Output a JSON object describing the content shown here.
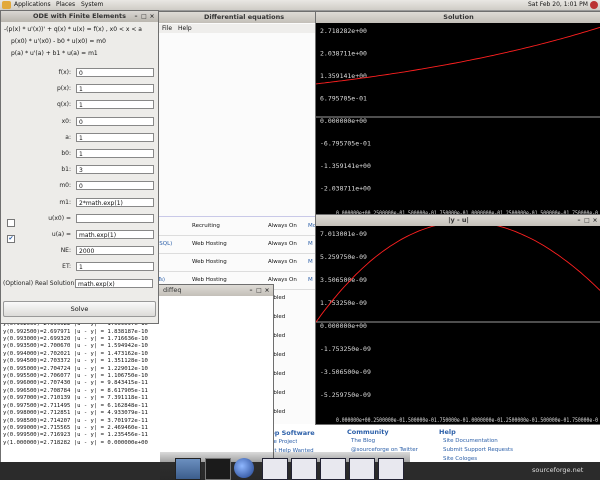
{
  "top_panel": {
    "menus": [
      "Applications",
      "Places",
      "System"
    ],
    "clock": "Sat Feb 20,  1:01 PM"
  },
  "diffeq_window": {
    "title": "Differential equations",
    "menu": [
      "File",
      "Help"
    ],
    "table_rows": [
      {
        "name": "",
        "category": "Recruiting",
        "status": "Always On",
        "mark": "Mo"
      },
      {
        "name": "ySQL)",
        "category": "Web Hosting",
        "status": "Always On",
        "mark": "M"
      },
      {
        "name": "",
        "category": "Web Hosting",
        "status": "Always On",
        "mark": "M"
      },
      {
        "name": "ITs)",
        "category": "Web Hosting",
        "status": "Always On",
        "mark": "M"
      }
    ],
    "side_words": [
      "abled",
      "abled",
      "abled",
      "abled",
      "abled",
      "abled",
      "abled"
    ],
    "footer": {
      "col1_title": "lop Software",
      "col1_items": [
        "ate Project",
        "ect Help Wanted"
      ],
      "col2_title": "Community",
      "col2_items": [
        "The Blog",
        "@sourceforge on Twitter"
      ],
      "col3_title": "Help",
      "col3_items": [
        "Site Documentation",
        "Submit Support Requests",
        "Site Cologes"
      ],
      "brand": "sourceforge.net"
    }
  },
  "ode_window": {
    "title": "ODE with Finite Elements",
    "equations": [
      "-(p(x) * u'(x))' + q(x) * u(x) = f(x)    , x0 < x < a",
      "p(x0) * u'(x0) - b0 * u(x0) = m0",
      "p(a) * u'(a) + b1 * u(a) = m1"
    ],
    "fields": [
      {
        "label": "f(x):",
        "value": "0"
      },
      {
        "label": "p(x):",
        "value": "1"
      },
      {
        "label": "q(x):",
        "value": "1"
      },
      {
        "label": "x0:",
        "value": "0"
      },
      {
        "label": "a:",
        "value": "1"
      },
      {
        "label": "b0:",
        "value": "1"
      },
      {
        "label": "b1:",
        "value": "3"
      },
      {
        "label": "m0:",
        "value": "0"
      },
      {
        "label": "m1:",
        "value": "2*math.exp(1)"
      },
      {
        "label": "u(x0) =",
        "value": ""
      },
      {
        "label": "u(a) =",
        "value": "math.exp(1)"
      },
      {
        "label": "NE:",
        "value": "2000"
      },
      {
        "label": "ET:",
        "value": "1"
      },
      {
        "label": "(Optional) Real Solution:",
        "value": "math.exp(x)"
      }
    ],
    "checkbox_u0_checked": false,
    "checkbox_ua_checked": true,
    "solve_label": "Solve"
  },
  "console_window": {
    "title": "diffeq",
    "lines": [
      "y(0.990500)=2.692580 |u - y| = 2.322882e-10",
      "y(0.991000)=2.693927 |u - y| = 2.261980e-10",
      "y(0.991500)=2.695274 |u - y| = 2.080869e-10",
      "y(0.992000)=2.696622 |u - y| = 1.959597e-10",
      "y(0.992500)=2.697971 |u - y| = 1.838187e-10",
      "y(0.993000)=2.699320 |u - y| = 1.716636e-10",
      "y(0.993500)=2.700670 |u - y| = 1.594942e-10",
      "y(0.994000)=2.702021 |u - y| = 1.473162e-10",
      "y(0.994500)=2.703372 |u - y| = 1.351128e-10",
      "y(0.995000)=2.704724 |u - y| = 1.229012e-10",
      "y(0.995500)=2.706077 |u - y| = 1.106750e-10",
      "y(0.996000)=2.707430 |u - y| = 9.843415e-11",
      "y(0.996500)=2.708784 |u - y| = 8.617905e-11",
      "y(0.997000)=2.710139 |u - y| = 7.391118e-11",
      "y(0.997500)=2.711495 |u - y| = 6.162848e-11",
      "y(0.998000)=2.712851 |u - y| = 4.933079e-11",
      "y(0.998500)=2.714207 |u - y| = 3.701972e-11",
      "y(0.999000)=2.715565 |u - y| = 2.469460e-11",
      "y(0.999500)=2.716923 |u - y| = 1.235456e-11",
      "y(1.000000)=2.718282 |u - y| = 0.000000e+00"
    ]
  },
  "solution_window": {
    "title": "Solution",
    "y_ticks": [
      "2.718282e+00",
      "2.038711e+00",
      "1.359141e+00",
      "6.795705e-01",
      "0.000000e+00",
      "-6.795705e-01",
      "-1.359141e+00",
      "-2.038711e+00"
    ],
    "x_ticks_text": "0.000000e+00.2500000e-01.500000e-01.750000e-01.0000000e-01.2500000e-01.500000e-01.750000e-0"
  },
  "error_window": {
    "title": "|y - u|",
    "y_ticks": [
      "7.013001e-09",
      "5.259750e-09",
      "3.506500e-09",
      "1.753250e-09",
      "0.000000e+00",
      "-1.753250e-09",
      "-3.506500e-09",
      "-5.259750e-09"
    ],
    "x_ticks_text": "0.000000e+00.2500000e-01.500000e-01.750000e-01.0000000e-01.2500000e-01.500000e-01.750000e-0"
  },
  "colors": {
    "curve": "#ff2020",
    "plot_bg": "#000000",
    "axis": "#cfcfcf",
    "link": "#2a5ea8"
  }
}
